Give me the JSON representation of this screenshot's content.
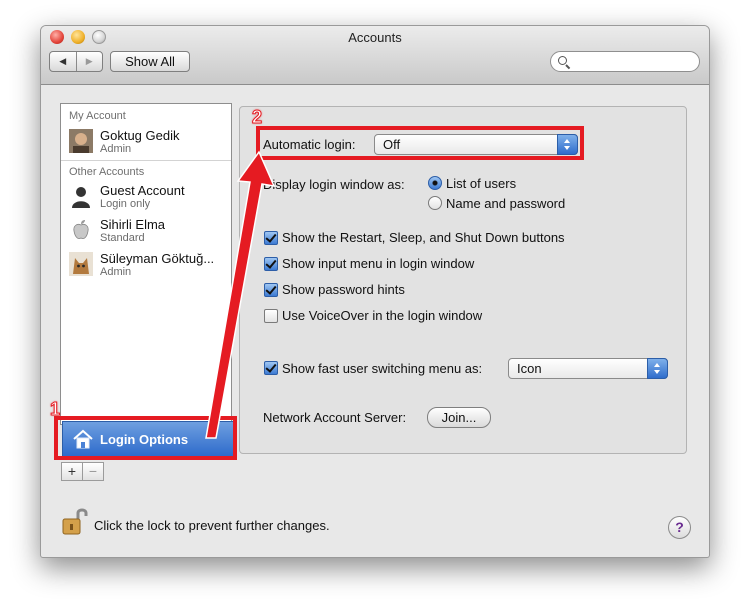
{
  "window": {
    "title": "Accounts"
  },
  "toolbar": {
    "back": "◀",
    "forward": "▶",
    "show_all": "Show All",
    "search_placeholder": ""
  },
  "sidebar": {
    "my_account_header": "My Account",
    "other_accounts_header": "Other Accounts",
    "accounts": [
      {
        "name": "Goktug Gedik",
        "role": "Admin",
        "avatar": "photo-avatar-icon"
      },
      {
        "name": "Guest Account",
        "role": "Login only",
        "avatar": "silhouette-icon"
      },
      {
        "name": "Sihirli Elma",
        "role": "Standard",
        "avatar": "apple-logo-icon"
      },
      {
        "name": "Süleyman Göktuğ...",
        "role": "Admin",
        "avatar": "cat-photo-icon"
      }
    ],
    "login_options": "Login Options",
    "add": "+",
    "remove": "−"
  },
  "panel": {
    "automatic_login_label": "Automatic login:",
    "automatic_login_value": "Off",
    "display_login_label": "Display login window as:",
    "radio_list": "List of users",
    "radio_name": "Name and password",
    "radio_selected": "List of users",
    "checkboxes": [
      {
        "label": "Show the Restart, Sleep, and Shut Down buttons",
        "checked": true
      },
      {
        "label": "Show input menu in login window",
        "checked": true
      },
      {
        "label": "Show password hints",
        "checked": true
      },
      {
        "label": "Use VoiceOver in the login window",
        "checked": false
      }
    ],
    "fast_switch_label": "Show fast user switching menu as:",
    "fast_switch_checked": true,
    "fast_switch_value": "Icon",
    "network_label": "Network Account Server:",
    "join_label": "Join..."
  },
  "footer": {
    "lock_text": "Click the lock to prevent further changes.",
    "help": "?"
  },
  "annotations": {
    "step1": "1",
    "step2": "2",
    "color": "#e51b22"
  }
}
